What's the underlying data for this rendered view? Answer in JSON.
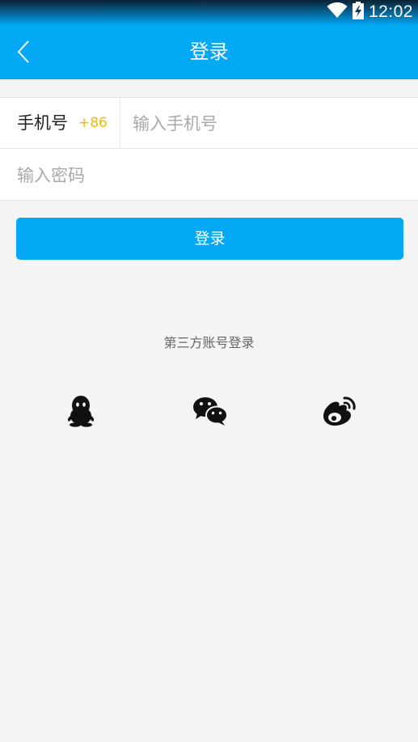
{
  "status_bar": {
    "time": "12:02"
  },
  "app_bar": {
    "title": "登录"
  },
  "form": {
    "phone_label": "手机号",
    "country_code": "+86",
    "phone_placeholder": "输入手机号",
    "phone_value": "",
    "password_placeholder": "输入密码",
    "password_value": ""
  },
  "login_button": {
    "label": "登录"
  },
  "third_party": {
    "label": "第三方账号登录",
    "providers": [
      {
        "icon": "qq-icon"
      },
      {
        "icon": "wechat-icon"
      },
      {
        "icon": "weibo-icon"
      }
    ]
  },
  "colors": {
    "primary": "#03a9f4",
    "country_code": "#f5b800",
    "background": "#f4f4f4"
  }
}
